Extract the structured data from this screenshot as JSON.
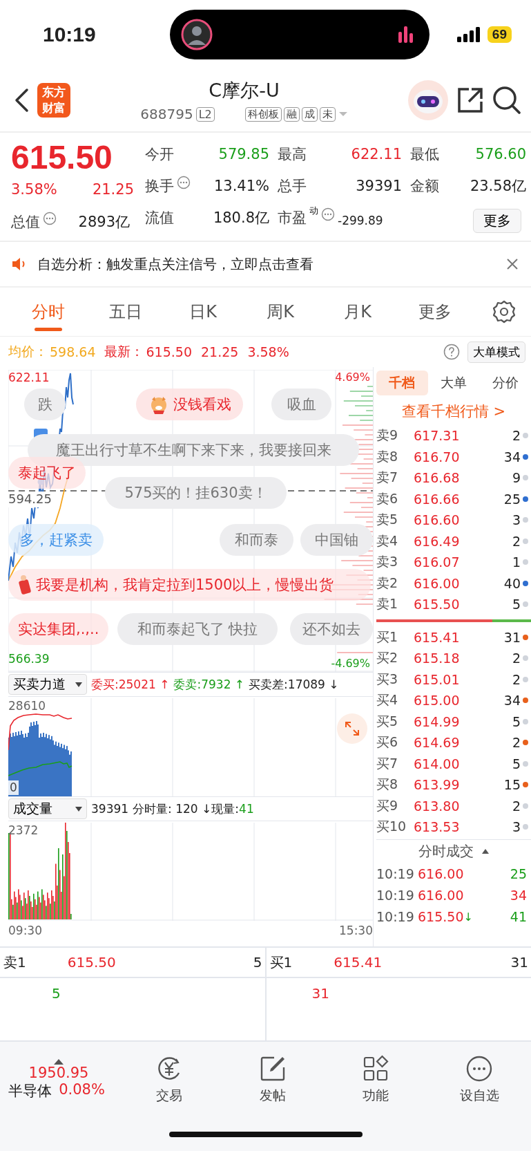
{
  "status_bar": {
    "time": "10:19",
    "battery": "69"
  },
  "header": {
    "logo": "东方财富",
    "title": "C摩尔-U",
    "code": "688795",
    "level_badge": "L2",
    "tags": [
      "科创板",
      "融",
      "成",
      "未"
    ]
  },
  "quote": {
    "price": "615.50",
    "change_pct": "3.58%",
    "change": "21.25",
    "stats": [
      {
        "label": "今开",
        "value": "579.85",
        "color": "#1a9e1a",
        "info": false
      },
      {
        "label": "最高",
        "value": "622.11",
        "color": "#e8262d",
        "info": false
      },
      {
        "label": "最低",
        "value": "576.60",
        "color": "#1a9e1a",
        "info": false
      },
      {
        "label": "换手",
        "value": "13.41%",
        "color": "#222222",
        "info": true
      },
      {
        "label": "总手",
        "value": "39391",
        "color": "#222222",
        "info": false
      },
      {
        "label": "金额",
        "value": "23.58亿",
        "color": "#222222",
        "info": false
      },
      {
        "label": "总值",
        "value": "2893亿",
        "color": "#222222",
        "info": true
      },
      {
        "label": "流值",
        "value": "180.8亿",
        "color": "#222222",
        "info": false
      },
      {
        "label": "市盈",
        "value": "-299.89",
        "color": "#222222",
        "info": true,
        "sup": "动"
      }
    ],
    "more_button": "更多"
  },
  "notice": {
    "text": "自选分析：触发重点关注信号，立即点击查看"
  },
  "period_tabs": [
    {
      "label": "分时",
      "selected": true
    },
    {
      "label": "五日",
      "selected": false
    },
    {
      "label": "日K",
      "selected": false
    },
    {
      "label": "周K",
      "selected": false
    },
    {
      "label": "月K",
      "selected": false
    },
    {
      "label": "更多",
      "selected": false
    }
  ],
  "info_line": {
    "avg_label": "均价：",
    "avg": "598.64",
    "latest_label": "最新：",
    "latest": "615.50",
    "change": "21.25",
    "change_pct": "3.58%",
    "mode_button": "大单模式"
  },
  "price_chart": {
    "high": "622.11",
    "low": "566.39",
    "pre_close": "594.25",
    "high_pct": "4.69%",
    "low_pct": "-4.69%"
  },
  "danmaku": [
    {
      "text": "跌",
      "kind": "grey"
    },
    {
      "text": "没钱看戏",
      "kind": "badge"
    },
    {
      "text": "吸血",
      "kind": "grey"
    },
    {
      "text": "魔王出行寸草不生啊下来下来，我要接回来",
      "kind": "grey"
    },
    {
      "text": "泰起飞了",
      "kind": "red"
    },
    {
      "text": "575买的！挂630卖！",
      "kind": "grey"
    },
    {
      "text": "多，赶紧卖",
      "kind": "blue"
    },
    {
      "text": "和而泰",
      "kind": "grey"
    },
    {
      "text": "中国铀",
      "kind": "grey"
    },
    {
      "text": "我要是机构，我肯定拉到1500以上，慢慢出货",
      "kind": "gift"
    },
    {
      "text": "实达集团,.,..",
      "kind": "red"
    },
    {
      "text": "和而泰起飞了 快拉",
      "kind": "grey"
    },
    {
      "text": "还不如去",
      "kind": "grey"
    }
  ],
  "force_panel": {
    "selector": "买卖力道",
    "buy": "委买:25021 ↑",
    "sell": "委卖:7932 ↑",
    "diff": "买卖差:17089 ↓",
    "max": "28610",
    "min": "0"
  },
  "volume_panel": {
    "selector": "成交量",
    "total": "39391",
    "minute": "分时量: 120 ↓",
    "now_label": "现量: ",
    "now": "41",
    "max": "2372",
    "start_time": "09:30",
    "end_time": "15:30"
  },
  "book_tabs": [
    {
      "label": "千档",
      "selected": true
    },
    {
      "label": "大单",
      "selected": false
    },
    {
      "label": "分价",
      "selected": false
    }
  ],
  "book_link": "查看千档行情 >",
  "asks": [
    {
      "label": "卖9",
      "price": "617.31",
      "volume": "2",
      "color": "#d0d4db"
    },
    {
      "label": "卖8",
      "price": "616.70",
      "volume": "34",
      "color": "#2f6fd0"
    },
    {
      "label": "卖7",
      "price": "616.68",
      "volume": "9",
      "color": "#d0d4db"
    },
    {
      "label": "卖6",
      "price": "616.66",
      "volume": "25",
      "color": "#2f6fd0"
    },
    {
      "label": "卖5",
      "price": "616.60",
      "volume": "3",
      "color": "#d0d4db"
    },
    {
      "label": "卖4",
      "price": "616.49",
      "volume": "2",
      "color": "#d0d4db"
    },
    {
      "label": "卖3",
      "price": "616.07",
      "volume": "1",
      "color": "#d0d4db"
    },
    {
      "label": "卖2",
      "price": "616.00",
      "volume": "40",
      "color": "#2f6fd0"
    },
    {
      "label": "卖1",
      "price": "615.50",
      "volume": "5",
      "color": "#d0d4db"
    }
  ],
  "book_balance": {
    "level": 0.75
  },
  "bids": [
    {
      "label": "买1",
      "price": "615.41",
      "volume": "31",
      "color": "#e8601c"
    },
    {
      "label": "买2",
      "price": "615.18",
      "volume": "2",
      "color": "#d0d4db"
    },
    {
      "label": "买3",
      "price": "615.01",
      "volume": "2",
      "color": "#d0d4db"
    },
    {
      "label": "买4",
      "price": "615.00",
      "volume": "34",
      "color": "#e8601c"
    },
    {
      "label": "买5",
      "price": "614.99",
      "volume": "5",
      "color": "#d0d4db"
    },
    {
      "label": "买6",
      "price": "614.69",
      "volume": "2",
      "color": "#e8601c"
    },
    {
      "label": "买7",
      "price": "614.00",
      "volume": "5",
      "color": "#d0d4db"
    },
    {
      "label": "买8",
      "price": "613.99",
      "volume": "15",
      "color": "#e8601c"
    },
    {
      "label": "买9",
      "price": "613.80",
      "volume": "2",
      "color": "#d0d4db"
    },
    {
      "label": "买10",
      "price": "613.53",
      "volume": "3",
      "color": "#d0d4db"
    }
  ],
  "trades_title": "分时成交",
  "trades": [
    {
      "time": "10:19",
      "price": "616.00",
      "volume": "25",
      "color": "#1a9e1a"
    },
    {
      "time": "10:19",
      "price": "616.00",
      "volume": "34",
      "color": "#e8262d"
    },
    {
      "time": "10:19",
      "price": "615.50",
      "volume": "41",
      "color": "#1a9e1a",
      "arrow": "↓"
    }
  ],
  "bottom_quote": [
    {
      "label": "卖1",
      "price": "615.50",
      "volume": "5",
      "detail": "5",
      "color": "#1a9e1a"
    },
    {
      "label": "买1",
      "price": "615.41",
      "volume": "31",
      "detail": "31",
      "color": "#e8262d"
    }
  ],
  "bottom_bar": {
    "index_value": "1950.95",
    "index_name": "半导体",
    "index_pct": "0.08%",
    "items": [
      {
        "label": "交易",
        "kind": "trade"
      },
      {
        "label": "发帖",
        "kind": "post"
      },
      {
        "label": "功能",
        "kind": "apps"
      },
      {
        "label": "设自选",
        "kind": "more"
      }
    ]
  }
}
